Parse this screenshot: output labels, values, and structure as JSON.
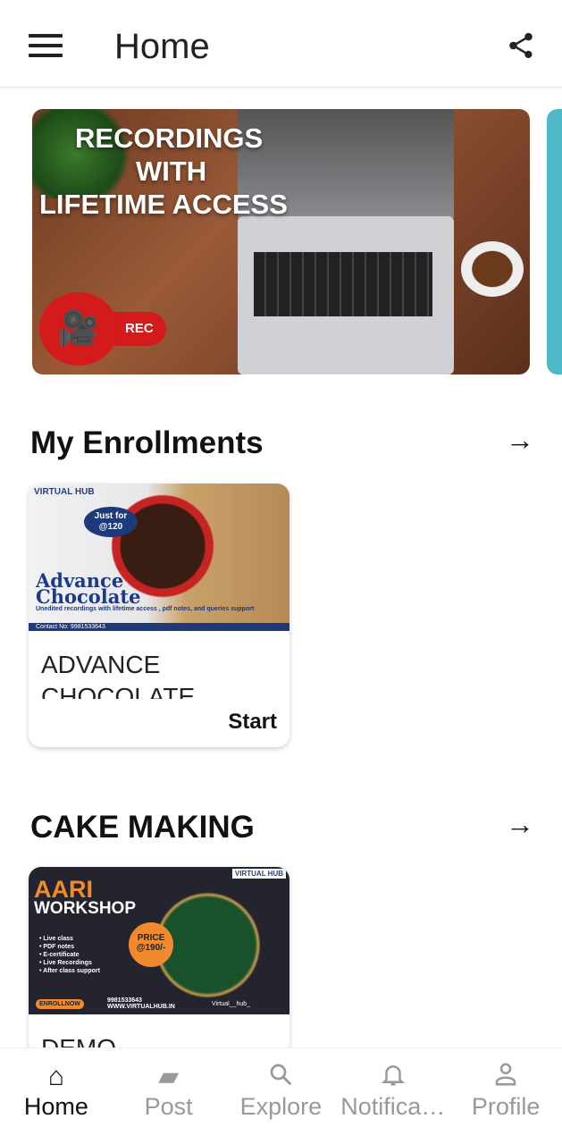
{
  "header": {
    "title": "Home",
    "menu_icon": "hamburger-menu-icon",
    "share_icon": "share-icon"
  },
  "banner": {
    "line1": "RECORDINGS",
    "line2": "WITH",
    "line3": "LIFETIME ACCESS",
    "rec_label": "REC",
    "icon": "video-camera-icon"
  },
  "enrollments": {
    "title": "My Enrollments",
    "card": {
      "brand": "VIRTUAL HUB",
      "badge_line1": "Just for",
      "badge_line2": "@120",
      "image_title_1": "Advance",
      "image_title_2": "Chocolate",
      "image_subtitle": "Unedited recordings with lifetime access , pdf notes, and queries support",
      "contact": "Contact No: 9981533643",
      "title": "ADVANCE CHOCOLATE MAKING",
      "action": "Start"
    }
  },
  "cake": {
    "title": "CAKE MAKING",
    "card": {
      "brand": "VIRTUAL HUB",
      "image_title_1": "AARI",
      "image_title_2": "WORKSHOP",
      "price_line1": "PRICE",
      "price_line2": "@190/-",
      "features": [
        "Live class",
        "PDF notes",
        "E-certificate",
        "Live Recordings",
        "After class support"
      ],
      "enroll": "ENROLLNOW",
      "phone": "9981533643",
      "website": "WWW.VIRTUALHUB.IN",
      "instagram": "Virtual__hub_",
      "title": "DEMO"
    }
  },
  "bottom_nav": [
    {
      "label": "Home",
      "icon": "home-icon",
      "active": true
    },
    {
      "label": "Post",
      "icon": "post-icon"
    },
    {
      "label": "Explore",
      "icon": "search-icon"
    },
    {
      "label": "Notifications",
      "icon": "bell-icon"
    },
    {
      "label": "Profile",
      "icon": "profile-icon"
    }
  ]
}
